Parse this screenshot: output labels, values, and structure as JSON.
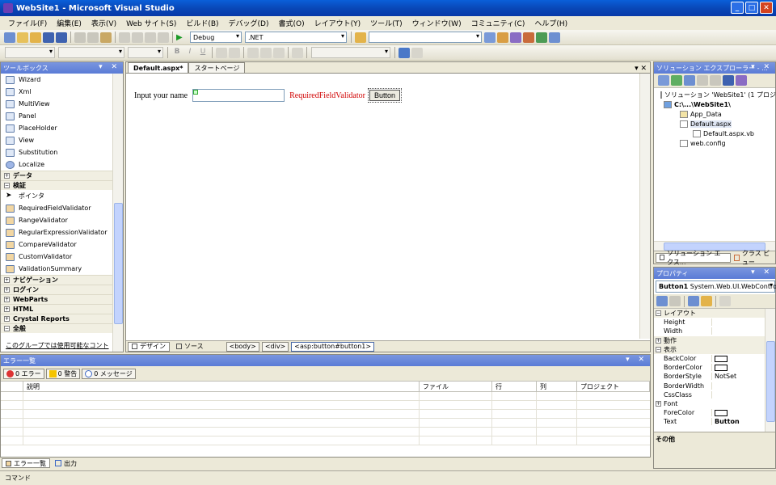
{
  "window": {
    "title": "WebSite1 - Microsoft Visual Studio"
  },
  "menu": [
    "ファイル(F)",
    "編集(E)",
    "表示(V)",
    "Web サイト(S)",
    "ビルド(B)",
    "デバッグ(D)",
    "書式(O)",
    "レイアウト(Y)",
    "ツール(T)",
    "ウィンドウ(W)",
    "コミュニティ(C)",
    "ヘルプ(H)"
  ],
  "toolbar": {
    "config": "Debug",
    "platform": ".NET",
    "bold": "B",
    "italic": "I",
    "underline": "U"
  },
  "toolbox": {
    "title": "ツールボックス",
    "items": [
      "Wizard",
      "Xml",
      "MultiView",
      "Panel",
      "PlaceHolder",
      "View",
      "Substitution",
      "Localize"
    ],
    "cat_data": "データ",
    "cat_validation": "検証",
    "validation_items": [
      "ポインタ",
      "RequiredFieldValidator",
      "RangeValidator",
      "RegularExpressionValidator",
      "CompareValidator",
      "CustomValidator",
      "ValidationSummary"
    ],
    "cats_after": [
      "ナビゲーション",
      "ログイン",
      "WebParts",
      "HTML",
      "Crystal Reports",
      "全般"
    ],
    "footer": "このグループでは使用可能なコント"
  },
  "editor": {
    "tab_active": "Default.aspx*",
    "tab_other": "スタートページ",
    "label": "Input your name",
    "validator": "RequiredFieldValidator",
    "button": "Button",
    "design_tab": "デザイン",
    "source_tab": "ソース",
    "crumbs": [
      "<body>",
      "<div>",
      "<asp:button#button1>"
    ]
  },
  "errors": {
    "title": "エラー一覧",
    "btn_errors": "0 エラー",
    "btn_warnings": "0 警告",
    "btn_messages": "0 メッセージ",
    "cols": [
      "説明",
      "ファイル",
      "行",
      "列",
      "プロジェクト"
    ],
    "tab_errors": "エラー一覧",
    "tab_output": "出力"
  },
  "solution": {
    "title": "ソリューション エクスプローラー - ...",
    "items": [
      "ソリューション 'WebSite1' (1 プロジェ",
      "C:\\...\\WebSite1\\",
      "App_Data",
      "Default.aspx",
      "Default.aspx.vb",
      "web.config"
    ],
    "tab_sol": "ソリューション エクス...",
    "tab_class": "クラス ビュー"
  },
  "properties": {
    "title": "プロパティ",
    "object": "Button1",
    "object_type": "System.Web.UI.WebContro",
    "cat_layout": "レイアウト",
    "cat_behavior": "動作",
    "cat_appearance": "表示",
    "rows_layout": [
      {
        "k": "Height",
        "v": ""
      },
      {
        "k": "Width",
        "v": ""
      }
    ],
    "rows_appearance": [
      {
        "k": "BackColor",
        "v": ""
      },
      {
        "k": "BorderColor",
        "v": ""
      },
      {
        "k": "BorderStyle",
        "v": "NotSet"
      },
      {
        "k": "BorderWidth",
        "v": ""
      },
      {
        "k": "CssClass",
        "v": ""
      }
    ],
    "font": "Font",
    "rows_after": [
      {
        "k": "ForeColor",
        "v": ""
      },
      {
        "k": "Text",
        "v": "Button"
      }
    ],
    "footer": "その他"
  },
  "status": {
    "command": "コマンド"
  }
}
